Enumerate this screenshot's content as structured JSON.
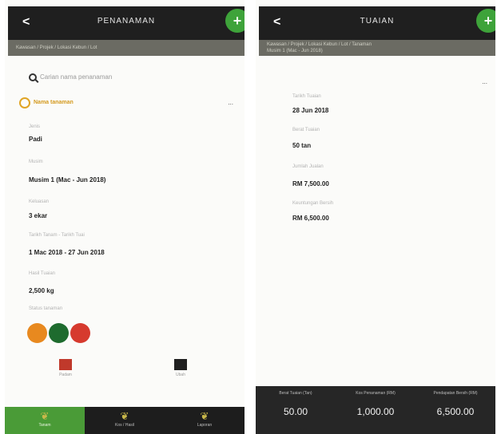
{
  "left": {
    "title": "PENANAMAN",
    "back": "<",
    "fab": "+",
    "subbar": "Kawasan / Projek / Lokasi Kebun / Lot",
    "search_placeholder": "Carian nama penanaman",
    "crop_name": "Nama tanaman",
    "more": "...",
    "fields": [
      {
        "label": "Jenis",
        "value": "Padi"
      },
      {
        "label": "Musim",
        "value": "Musim 1 (Mac - Jun 2018)"
      },
      {
        "label": "Keluasan",
        "value": "3 ekar"
      },
      {
        "label": "Tarikh Tanam - Tarikh Tuai",
        "value": "1 Mac 2018 - 27 Jun 2018"
      },
      {
        "label": "Hasil Tuaian",
        "value": "2,500 kg"
      }
    ],
    "status_label": "Status tanaman",
    "status_colors": {
      "orange": "#e8891f",
      "green": "#1e6b2e",
      "red": "#d63a2e"
    },
    "actions": {
      "delete": "Padam",
      "edit": "Ubah"
    },
    "nav": [
      {
        "label": "Tanam",
        "icon": "plant-icon"
      },
      {
        "label": "Kos / Hasil",
        "icon": "plant-icon"
      },
      {
        "label": "Laporan",
        "icon": "plant-icon"
      }
    ]
  },
  "right": {
    "title": "TUAIAN",
    "back": "<",
    "fab": "+",
    "subbar_line1": "Kawasan / Projek / Lokasi Kebun / Lot / Tanaman",
    "subbar_line2": "Musim 1 (Mac - Jun 2018)",
    "more": "...",
    "fields": [
      {
        "label": "Tarikh Tuaian",
        "value": "28 Jun 2018"
      },
      {
        "label": "Berat Tuaian",
        "value": "50 tan"
      },
      {
        "label": "Jumlah Jualan",
        "value": "RM 7,500.00"
      },
      {
        "label": "Keuntungan Bersih",
        "value": "RM 6,500.00"
      }
    ],
    "summary": [
      {
        "label": "Berat Tuaian (Tan)",
        "value": "50.00"
      },
      {
        "label": "Kos Penanaman (RM)",
        "value": "1,000.00"
      },
      {
        "label": "Pendapatan Bersih (RM)",
        "value": "6,500.00"
      }
    ]
  }
}
